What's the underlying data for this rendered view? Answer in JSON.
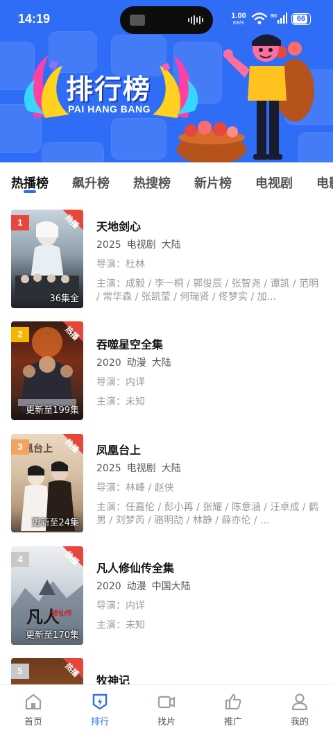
{
  "status_bar": {
    "time": "14:19",
    "net_speed_value": "1.00",
    "net_speed_unit": "KB/S",
    "signal_label": "5G",
    "battery": "66"
  },
  "banner": {
    "title": "排行榜",
    "subtitle": "PAI HANG BANG"
  },
  "tabs": [
    {
      "label": "热播榜",
      "active": true
    },
    {
      "label": "飙升榜"
    },
    {
      "label": "热搜榜"
    },
    {
      "label": "新片榜"
    },
    {
      "label": "电视剧"
    },
    {
      "label": "电影"
    }
  ],
  "list": [
    {
      "rank": "1",
      "badge": "热播",
      "episodes": "36集全",
      "title": "天地剑心",
      "year": "2025",
      "genre": "电视剧",
      "region": "大陆",
      "director": "导演：杜林",
      "cast": "主演：成毅 / 李一桐 / 郭俊辰 / 张智尧 / 谭凯 / 范明 / 常华森 / 张凯莹 / 何瑞贤 / 佟梦实 / 加..."
    },
    {
      "rank": "2",
      "badge": "热播",
      "episodes": "更新至199集",
      "title": "吞噬星空全集",
      "year": "2020",
      "genre": "动漫",
      "region": "大陆",
      "director": "导演：内详",
      "cast": "主演：未知"
    },
    {
      "rank": "3",
      "badge": "热播",
      "episodes": "更新至24集",
      "title": "凤凰台上",
      "year": "2025",
      "genre": "电视剧",
      "region": "大陆",
      "director": "导演：林峰 / 赵侠",
      "cast": "主演：任嘉伦 / 彭小苒 / 张耀 / 陈意涵 / 汪卓成 / 鹤男 / 刘梦芮 / 骆明劼 / 林静 / 薛亦伦 / ..."
    },
    {
      "rank": "4",
      "badge": "热播",
      "episodes": "更新至170集",
      "title": "凡人修仙传全集",
      "year": "2020",
      "genre": "动漫",
      "region": "中国大陆",
      "director": "导演：内详",
      "cast": "主演：未知"
    },
    {
      "rank": "5",
      "badge": "热播",
      "episodes": "",
      "title": "牧神记",
      "year": "",
      "genre": "",
      "region": "",
      "director": "",
      "cast": ""
    }
  ],
  "rank_colors": [
    "#e8453c",
    "#f4b400",
    "#f2a35e",
    "#c8c8c8",
    "#c8c8c8"
  ],
  "bottom_nav": [
    {
      "label": "首页",
      "icon": "home-icon"
    },
    {
      "label": "排行",
      "icon": "ranking-icon",
      "active": true
    },
    {
      "label": "找片",
      "icon": "video-camera-icon"
    },
    {
      "label": "推广",
      "icon": "thumbs-up-icon"
    },
    {
      "label": "我的",
      "icon": "user-icon"
    }
  ],
  "colors": {
    "accent": "#2f6df6",
    "hot_badge": "#e8453c"
  }
}
